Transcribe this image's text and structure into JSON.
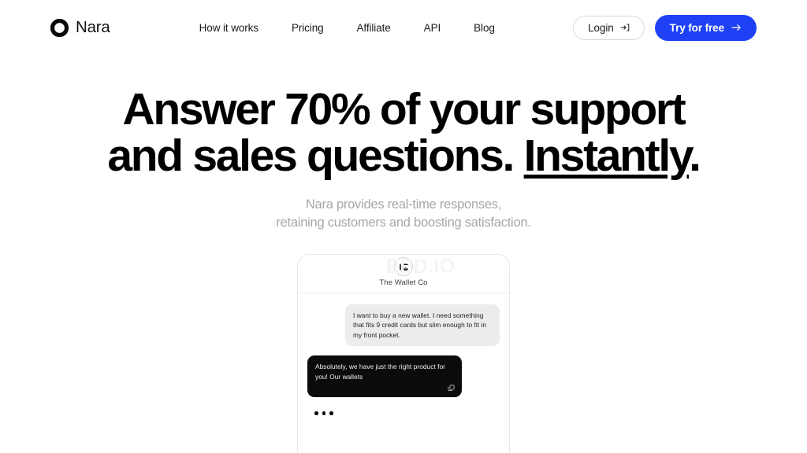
{
  "brand": {
    "name": "Nara",
    "logo_icon": "ring-logo-icon"
  },
  "nav": {
    "links": [
      {
        "label": "How it works"
      },
      {
        "label": "Pricing"
      },
      {
        "label": "Affiliate"
      },
      {
        "label": "API"
      },
      {
        "label": "Blog"
      }
    ],
    "login_label": "Login",
    "login_icon": "sign-in-icon",
    "cta_label": "Try for free",
    "cta_icon": "arrow-right-icon",
    "cta_color": "#1f41f5"
  },
  "hero": {
    "headline_line1_a": "Answer 70% of your support",
    "headline_line2_a": "and sales questions. ",
    "headline_emphasis": "Instantly",
    "headline_line2_b": ".",
    "subhead_line1": "Nara provides real-time responses,",
    "subhead_line2": "retaining customers and boosting satisfaction."
  },
  "chat": {
    "watermark": "EED.IO",
    "company_name": "The Wallet Co",
    "avatar_icon": "wallet-icon",
    "messages": [
      {
        "role": "user",
        "text": "I want to buy a new wallet. I need something that fits 9 credit cards but slim enough to fit in my front pocket."
      },
      {
        "role": "bot",
        "text": "Absolutely, we have just the right product for you! Our wallets",
        "copy_icon": "copy-icon"
      }
    ],
    "typing_indicator": "typing-dots"
  }
}
